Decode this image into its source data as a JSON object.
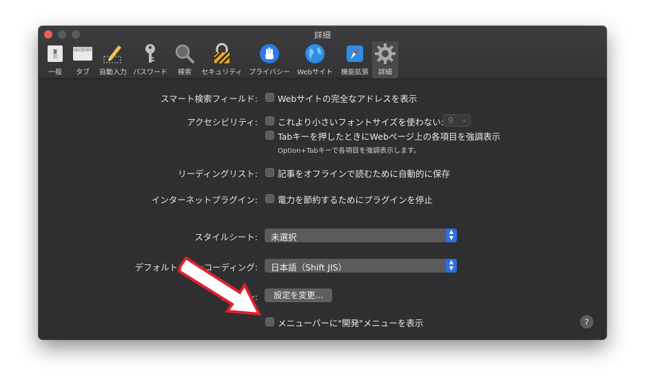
{
  "window": {
    "title": "詳細"
  },
  "toolbar": {
    "items": [
      {
        "label": "一般",
        "icon": "general-switch-icon"
      },
      {
        "label": "タブ",
        "icon": "tabs-icon"
      },
      {
        "label": "自動入力",
        "icon": "autofill-pencil-icon"
      },
      {
        "label": "パスワード",
        "icon": "key-icon"
      },
      {
        "label": "検索",
        "icon": "magnifier-icon"
      },
      {
        "label": "セキュリティ",
        "icon": "lock-icon"
      },
      {
        "label": "プライバシー",
        "icon": "hand-icon"
      },
      {
        "label": "Webサイト",
        "icon": "globe-icon"
      },
      {
        "label": "機能拡張",
        "icon": "extensions-compass-icon"
      },
      {
        "label": "詳細",
        "icon": "gear-icon",
        "selected": true
      }
    ]
  },
  "settings": {
    "smart_search_label": "スマート検索フィールド:",
    "smart_search_option": "Webサイトの完全なアドレスを表示",
    "accessibility_label": "アクセシビリティ:",
    "accessibility_font_option": "これより小さいフォントサイズを使わない:",
    "font_size_value": "9",
    "accessibility_tab_option": "Tabキーを押したときにWebページ上の各項目を強調表示",
    "accessibility_note": "Option+Tabキーで各項目を強調表示します。",
    "reading_list_label": "リーディングリスト:",
    "reading_list_option": "記事をオフラインで読むために自動的に保存",
    "plugins_label": "インターネットプラグイン:",
    "plugins_option": "電力を節約するためにプラグインを停止",
    "stylesheet_label": "スタイルシート:",
    "stylesheet_value": "未選択",
    "encoding_label": "デフォルトのエンコーディング:",
    "encoding_value": "日本語（Shift JIS）",
    "proxy_label": "プロキシ:",
    "proxy_button": "設定を変更...",
    "develop_menu_option": "メニューバーに\"開発\"メニューを表示",
    "help": "?"
  },
  "colors": {
    "window_bg": "#2f2f31",
    "accent": "#2f6fe0",
    "annotation_arrow": "#e0212b"
  }
}
